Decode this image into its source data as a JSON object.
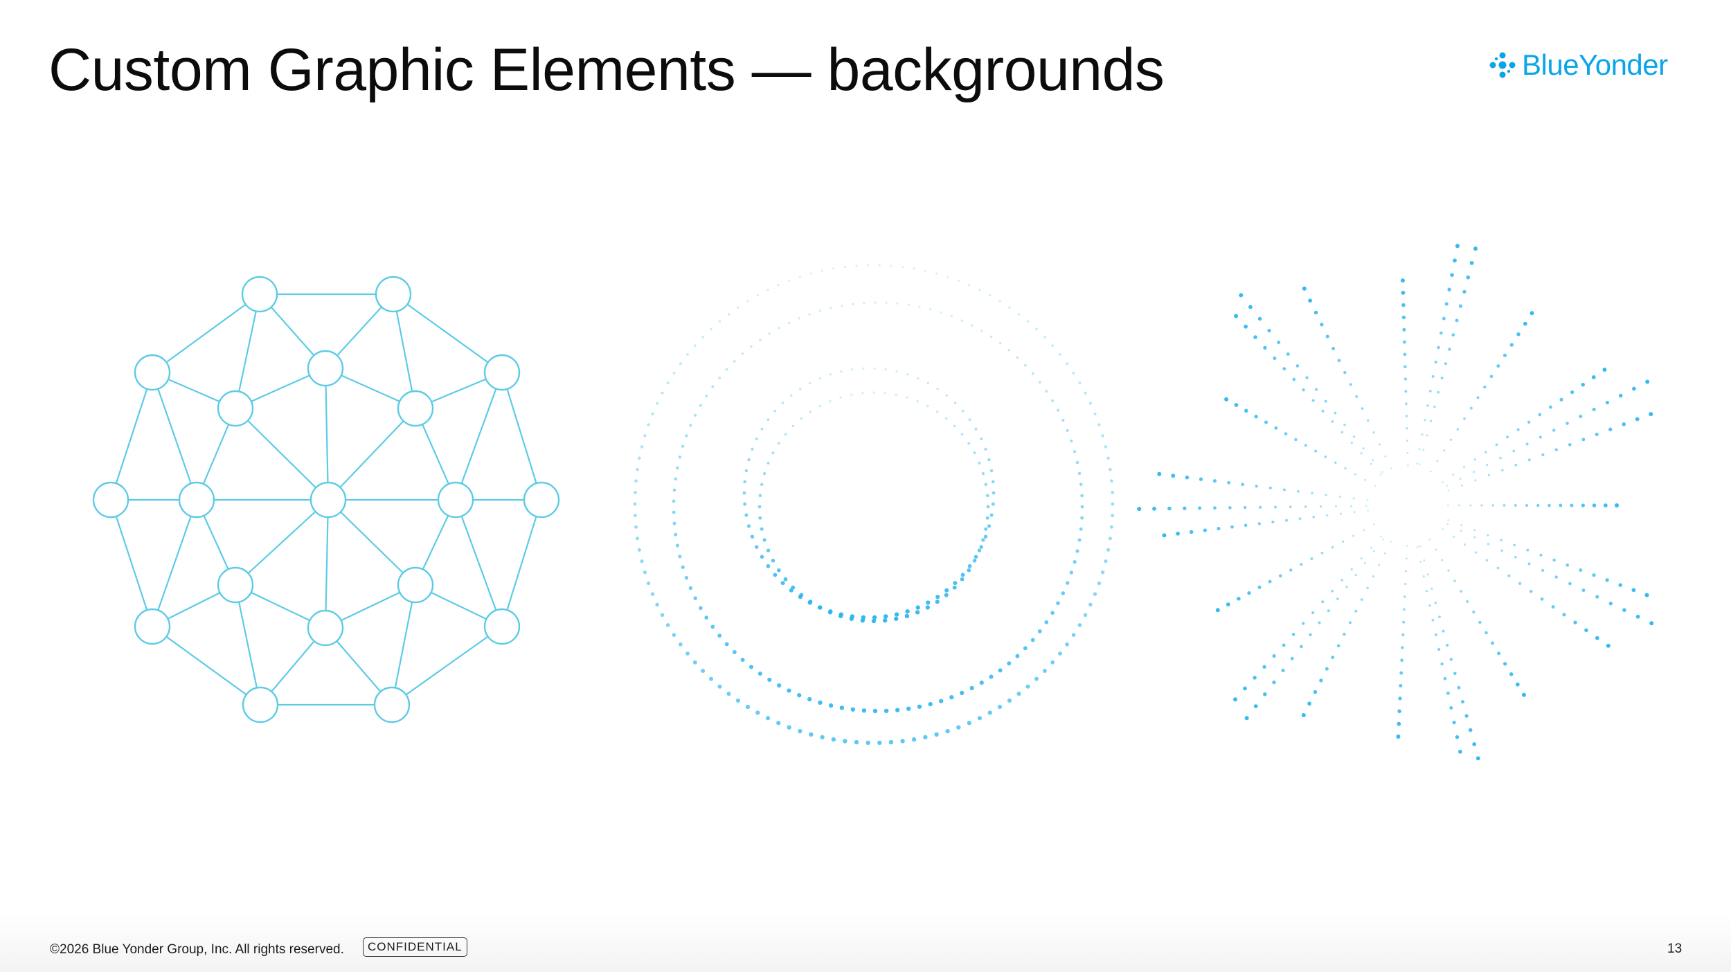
{
  "slide": {
    "title": "Custom Graphic Elements — backgrounds",
    "logo": {
      "text": "BlueYonder",
      "icon": "blue-yonder-logo-icon",
      "color": "#0aa5e8"
    },
    "footer": {
      "copyright": "©2026 Blue Yonder Group, Inc. All rights reserved.",
      "badge": "CONFIDENTIAL",
      "page_number": "13"
    },
    "graphics": [
      {
        "name": "network-mesh-graphic",
        "style": "outline nodes and connecting lines",
        "color": "#5ccbe6"
      },
      {
        "name": "dotted-concentric-rings-graphic",
        "style": "dotted concentric circles",
        "color": "#29b6ee"
      },
      {
        "name": "dotted-radial-burst-graphic",
        "style": "dotted rays radiating from center",
        "color": "#29b6ee"
      }
    ]
  }
}
